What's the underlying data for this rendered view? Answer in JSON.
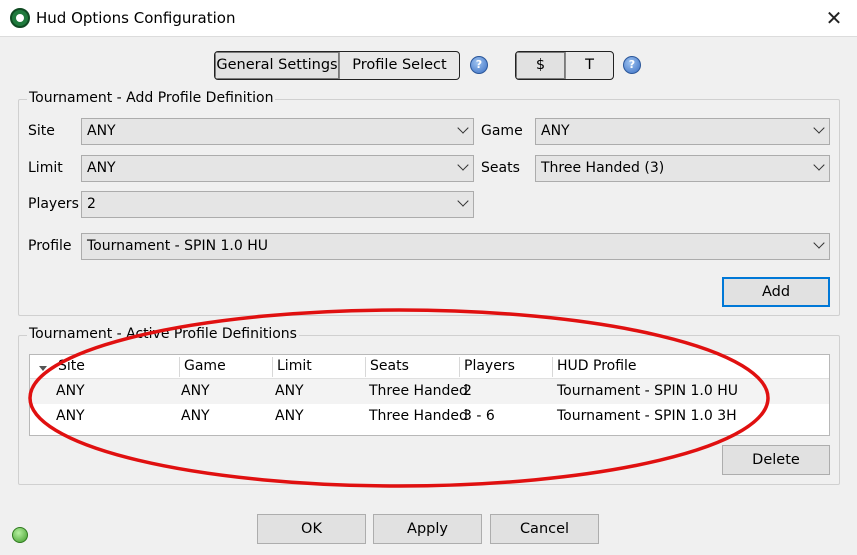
{
  "window": {
    "title": "Hud Options Configuration",
    "close_glyph": "✕"
  },
  "tabs": {
    "general": "General Settings",
    "profile": "Profile Select",
    "dollar": "$",
    "t": "T",
    "help_glyph": "?"
  },
  "add_group": {
    "label": "Tournament - Add Profile Definition",
    "site_label": "Site",
    "site_value": "ANY",
    "game_label": "Game",
    "game_value": "ANY",
    "limit_label": "Limit",
    "limit_value": "ANY",
    "seats_label": "Seats",
    "seats_value": "Three Handed (3)",
    "players_label": "Players",
    "players_value": "2",
    "profile_label": "Profile",
    "profile_value": "Tournament - SPIN 1.0 HU",
    "add_button": "Add"
  },
  "active_group": {
    "label": "Tournament - Active Profile Definitions",
    "columns": [
      "Site",
      "Game",
      "Limit",
      "Seats",
      "Players",
      "HUD Profile"
    ],
    "rows": [
      [
        "ANY",
        "ANY",
        "ANY",
        "Three Handed",
        "2",
        "Tournament - SPIN 1.0 HU"
      ],
      [
        "ANY",
        "ANY",
        "ANY",
        "Three Handed",
        "3 - 6",
        "Tournament - SPIN 1.0 3H"
      ]
    ],
    "delete_button": "Delete"
  },
  "footer": {
    "ok": "OK",
    "apply": "Apply",
    "cancel": "Cancel"
  },
  "colors": {
    "annotation": "#e01010",
    "accent": "#0078d7"
  }
}
